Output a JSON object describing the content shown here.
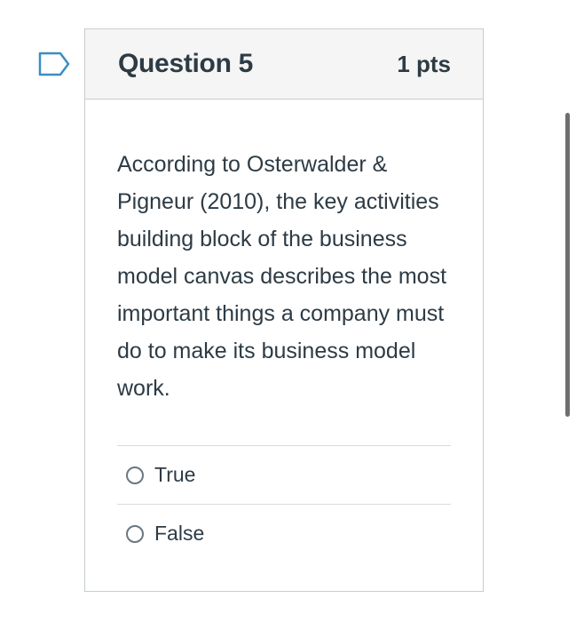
{
  "question": {
    "title": "Question 5",
    "points": "1 pts",
    "text": "According to Osterwalder & Pigneur (2010), the key activities building block of the business model canvas describes the most important things a company must do to make its business model work.",
    "answers": [
      {
        "label": "True",
        "selected": false
      },
      {
        "label": "False",
        "selected": false
      }
    ]
  },
  "icons": {
    "flag": "flag-icon",
    "radio": "radio-button-icon"
  },
  "colors": {
    "text": "#2d3b45",
    "header_bg": "#f5f5f5",
    "border": "#c7cdd1",
    "divider": "#d8dcdf",
    "flag_blue": "#3c8dc4",
    "scrollbar": "#6e6e6e"
  }
}
